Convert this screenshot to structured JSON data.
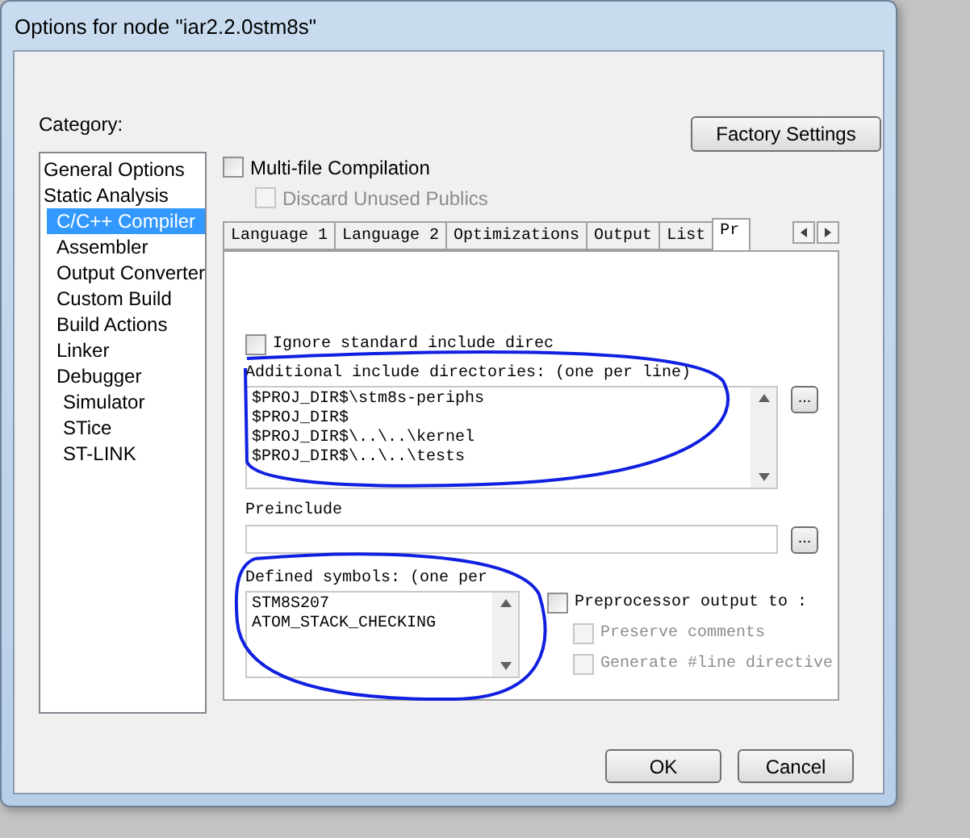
{
  "window": {
    "title": "Options for node \"iar2.2.0stm8s\""
  },
  "category": {
    "label": "Category:",
    "items": [
      {
        "label": "General Options",
        "selected": false
      },
      {
        "label": "Static Analysis",
        "selected": false,
        "children": [
          {
            "label": "C/C++ Compiler",
            "selected": true
          },
          {
            "label": "Assembler",
            "selected": false
          },
          {
            "label": "Output Converter",
            "selected": false
          },
          {
            "label": "Custom Build",
            "selected": false
          },
          {
            "label": "Build Actions",
            "selected": false
          },
          {
            "label": "Linker",
            "selected": false
          },
          {
            "label": "Debugger",
            "selected": false,
            "children": [
              {
                "label": "Simulator",
                "selected": false
              },
              {
                "label": "STice",
                "selected": false
              },
              {
                "label": "ST-LINK",
                "selected": false
              }
            ]
          }
        ]
      }
    ]
  },
  "factory_button": "Factory Settings",
  "top_options": [
    {
      "label": "Multi-file Compilation",
      "checked": false,
      "disabled": false
    },
    {
      "label": "Discard Unused Publics",
      "checked": false,
      "disabled": true
    }
  ],
  "tabs": [
    {
      "label": "Language 1",
      "selected": false
    },
    {
      "label": "Language 2",
      "selected": false
    },
    {
      "label": "Optimizations",
      "selected": false
    },
    {
      "label": "Output",
      "selected": false
    },
    {
      "label": "List",
      "selected": false
    },
    {
      "label": "Pr",
      "selected": true
    }
  ],
  "ignore_option": {
    "label": "Ignore standard include direc",
    "checked": false
  },
  "include_dirs": {
    "label": "Additional include directories: (one per line)",
    "lines": [
      "$PROJ_DIR$\\stm8s-periphs",
      "$PROJ_DIR$",
      "$PROJ_DIR$\\..\\..\\kernel",
      "$PROJ_DIR$\\..\\..\\tests"
    ],
    "browse": "..."
  },
  "preinclude": {
    "label": "Preinclude",
    "browse": "..."
  },
  "defined_symbols": {
    "label": "Defined symbols: (one per",
    "lines": [
      "STM8S207",
      "ATOM_STACK_CHECKING"
    ]
  },
  "preprocessor": {
    "label": "Preprocessor output to :",
    "checked": false,
    "options": [
      {
        "label": "Preserve comments",
        "checked": false,
        "disabled": true
      },
      {
        "label": "Generate #line directive",
        "checked": false,
        "disabled": true
      }
    ]
  },
  "buttons": [
    "OK",
    "Cancel"
  ]
}
